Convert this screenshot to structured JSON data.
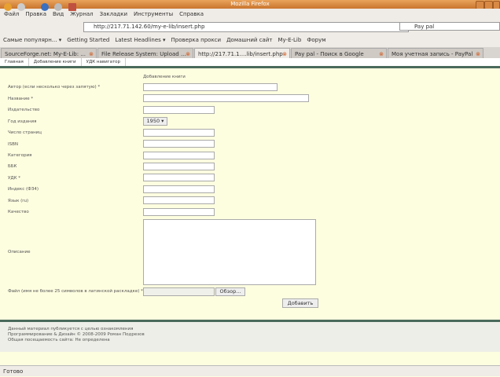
{
  "window": {
    "title": "Mozilla Firefox"
  },
  "menu": [
    "Файл",
    "Правка",
    "Вид",
    "Журнал",
    "Закладки",
    "Инструменты",
    "Справка"
  ],
  "nav": {
    "url": "http://217.71.142.60/my-e-lib/insert.php",
    "search": "Pay pal"
  },
  "bookmarks": [
    "Самые популярн... ▾",
    "Getting Started",
    "Latest Headlines ▾",
    "Проверка прокси",
    "Домашний сайт",
    "My-E-Lib",
    "Форум"
  ],
  "tabs": [
    "SourceForge.net: My-E-Lib: ...",
    "File Release System: Upload ...",
    "http://217.71.1....lib/insert.php",
    "Pay pal - Поиск в Google",
    "Моя учетная запись - PayPal"
  ],
  "page_nav": [
    "Главная",
    "Добавление книги",
    "УДК навигатор"
  ],
  "form": {
    "heading": "Добавление книги",
    "labels": [
      "Автор (если несколько через запятую) *",
      "Название *",
      "Издательство",
      "Год издания",
      "Число страниц",
      "ISBN",
      "Категория",
      "ББК",
      "УДК *",
      "Индекс (ФЗ4)",
      "Язык (ru)",
      "Качество"
    ],
    "year": "1950",
    "description_label": "Описание",
    "file_label": "Файл (имя не более 25 символов в латинской раскладке) *",
    "browse": "Обзор...",
    "submit": "Добавить"
  },
  "footer": [
    "Данный материал публикуется с целью ознакомления",
    "Программирование & Дизайн © 2008-2009 Роман Подрезов",
    "Общая посещаемость сайта: Не определена"
  ],
  "status": "Готово"
}
